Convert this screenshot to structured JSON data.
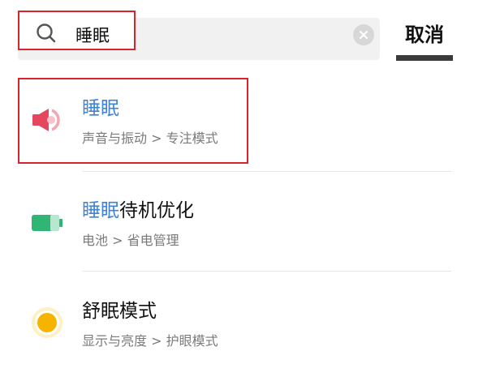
{
  "search": {
    "value": "睡眠",
    "cancel_label": "取消"
  },
  "results": [
    {
      "title_highlight": "睡眠",
      "title_rest": "",
      "path": "声音与振动 > 专注模式"
    },
    {
      "title_highlight": "睡眠",
      "title_rest": "待机优化",
      "path": "电池 > 省电管理"
    },
    {
      "title_highlight": "",
      "title_rest": "舒眠模式",
      "path": "显示与亮度 > 护眼模式"
    }
  ],
  "colors": {
    "highlight_text": "#3f83d4",
    "annotation_red": "#d9232d",
    "sound_icon": "#e5475e",
    "battery_icon": "#2fb574",
    "eye_comfort_icon": "#f6b400"
  }
}
